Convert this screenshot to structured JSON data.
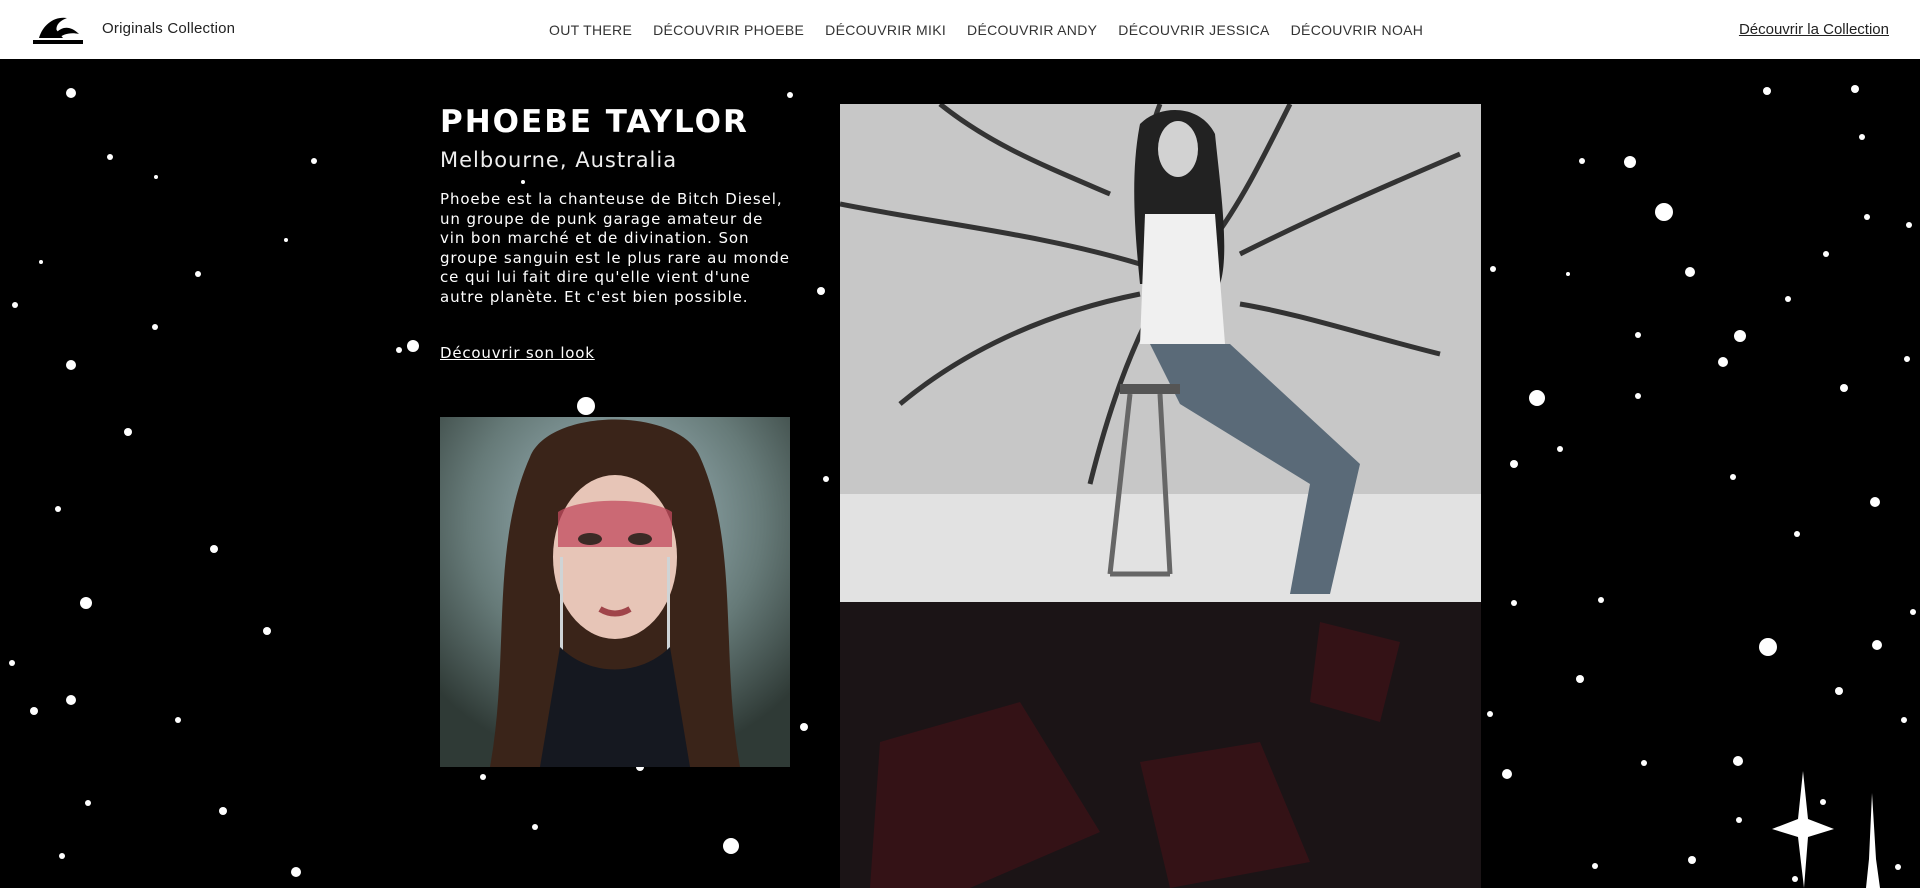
{
  "header": {
    "brand": "Originals Collection",
    "nav": [
      "OUT THERE",
      "DÉCOUVRIR PHOEBE",
      "DÉCOUVRIR MIKI",
      "DÉCOUVRIR ANDY",
      "DÉCOUVRIR JESSICA",
      "DÉCOUVRIR NOAH"
    ],
    "collection_link": "Découvrir la Collection"
  },
  "profile": {
    "name": "PHOEBE TAYLOR",
    "location": "Melbourne, Australia",
    "bio": "Phoebe est la chanteuse de Bitch Diesel, un groupe de punk garage amateur de vin bon marché et de divination. Son groupe sanguin est le plus rare au monde ce qui lui fait dire qu'elle vient d'une autre planète. Et c'est bien possible.",
    "look_link": "Découvrir son look"
  },
  "colors": {
    "background": "#000000",
    "header_bg": "#ffffff",
    "text_light": "#ffffff",
    "text_dark": "#222222"
  }
}
